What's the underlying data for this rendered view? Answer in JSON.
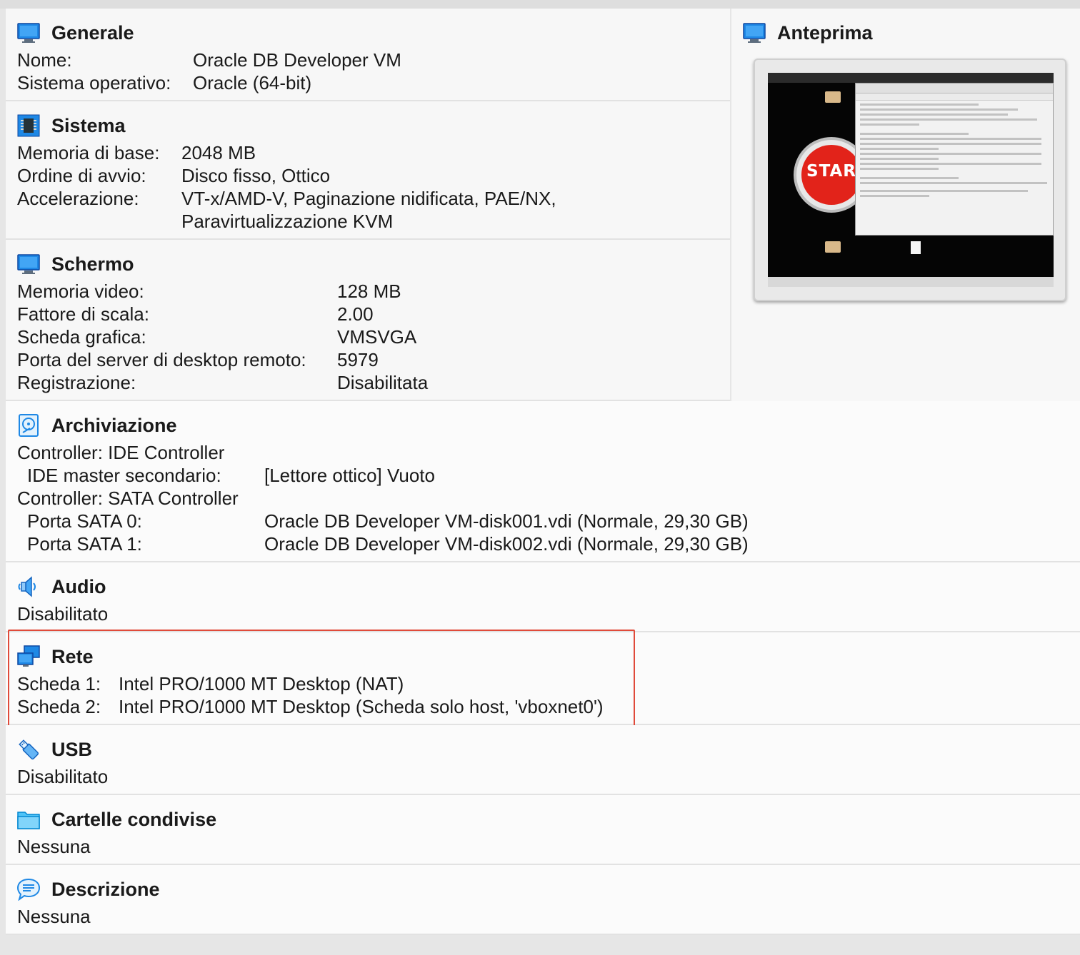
{
  "colors": {
    "highlight_box": "#e04a3a",
    "icon_blue": "#1e88e5",
    "section_bg": "#f7f7f7"
  },
  "generale": {
    "title": "Generale",
    "icon": "monitor-icon",
    "rows": [
      {
        "label": "Nome:",
        "value": "Oracle DB Developer VM"
      },
      {
        "label": "Sistema operativo:",
        "value": "Oracle (64-bit)"
      }
    ]
  },
  "anteprima": {
    "title": "Anteprima",
    "icon": "monitor-icon",
    "preview_start_label": "STAR"
  },
  "sistema": {
    "title": "Sistema",
    "icon": "chip-icon",
    "rows": [
      {
        "label": "Memoria di base:",
        "value": "2048 MB"
      },
      {
        "label": "Ordine di avvio:",
        "value": "Disco fisso, Ottico"
      },
      {
        "label": "Accelerazione:",
        "value": "VT-x/AMD-V, Paginazione nidificata, PAE/NX,"
      },
      {
        "label": "",
        "value": "Paravirtualizzazione KVM"
      }
    ]
  },
  "schermo": {
    "title": "Schermo",
    "icon": "monitor-icon",
    "rows": [
      {
        "label": "Memoria video:",
        "value": "128 MB"
      },
      {
        "label": "Fattore di scala:",
        "value": "2.00"
      },
      {
        "label": "Scheda grafica:",
        "value": "VMSVGA"
      },
      {
        "label": "Porta del server di desktop remoto:",
        "value": "5979"
      },
      {
        "label": "Registrazione:",
        "value": "Disabilitata"
      }
    ]
  },
  "archiviazione": {
    "title": "Archiviazione",
    "icon": "hard-disk-icon",
    "controller1": "Controller: IDE Controller",
    "ide_label": "IDE master secondario:",
    "ide_value": "[Lettore ottico] Vuoto",
    "controller2": "Controller: SATA Controller",
    "sata0_label": "Porta SATA 0:",
    "sata0_value": "Oracle DB Developer VM-disk001.vdi (Normale, 29,30 GB)",
    "sata1_label": "Porta SATA 1:",
    "sata1_value": "Oracle DB Developer VM-disk002.vdi (Normale, 29,30 GB)"
  },
  "audio": {
    "title": "Audio",
    "icon": "speaker-icon",
    "value": "Disabilitato"
  },
  "rete": {
    "title": "Rete",
    "icon": "network-icon",
    "rows": [
      {
        "label": "Scheda 1:",
        "value": "Intel PRO/1000 MT Desktop (NAT)"
      },
      {
        "label": "Scheda 2:",
        "value": "Intel PRO/1000 MT Desktop (Scheda solo host, 'vboxnet0')"
      }
    ]
  },
  "usb": {
    "title": "USB",
    "icon": "usb-icon",
    "value": "Disabilitato"
  },
  "cartelle": {
    "title": "Cartelle condivise",
    "icon": "folder-icon",
    "value": "Nessuna"
  },
  "descrizione": {
    "title": "Descrizione",
    "icon": "speech-bubble-icon",
    "value": "Nessuna"
  }
}
